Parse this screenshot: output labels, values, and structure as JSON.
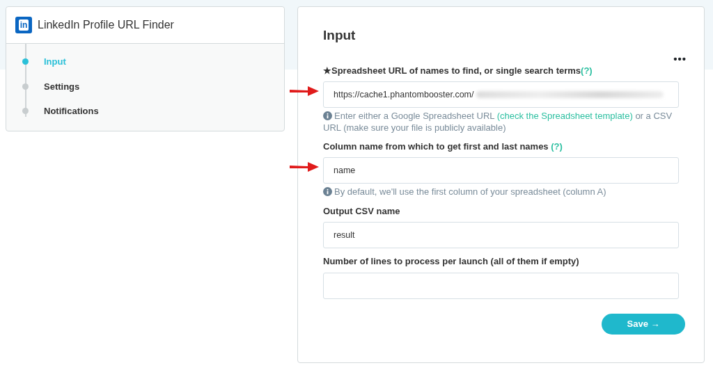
{
  "sidebar": {
    "title": "LinkedIn Profile URL Finder",
    "logo": "in",
    "steps": [
      {
        "label": "Input",
        "selected": true
      },
      {
        "label": "Settings",
        "selected": false
      },
      {
        "label": "Notifications",
        "selected": false
      }
    ]
  },
  "form": {
    "title": "Input",
    "menu": "•••",
    "fields": [
      {
        "marker": "★",
        "label": "Spreadsheet URL of names to find, or single search terms",
        "help": "(?)",
        "value": "https://cache1.phantombooster.com/",
        "blurred": true,
        "arrow": true,
        "hint": [
          {
            "kind": "text",
            "text": "Enter either a Google Spreadsheet URL "
          },
          {
            "kind": "link",
            "text": "(check the Spreadsheet template)"
          },
          {
            "kind": "text",
            "text": " or a CSV URL (make sure your file is publicly available)"
          }
        ]
      },
      {
        "label": "Column name from which to get first and last names",
        "help": "(?)",
        "value": "name",
        "arrow": true,
        "hint": [
          {
            "kind": "text",
            "text": "By default, we'll use the first column of your spreadsheet (column A)"
          }
        ]
      },
      {
        "label": "Output CSV name",
        "value": "result"
      },
      {
        "label": "Number of lines to process per launch (all of them if empty)"
      }
    ],
    "save": "Save →"
  }
}
